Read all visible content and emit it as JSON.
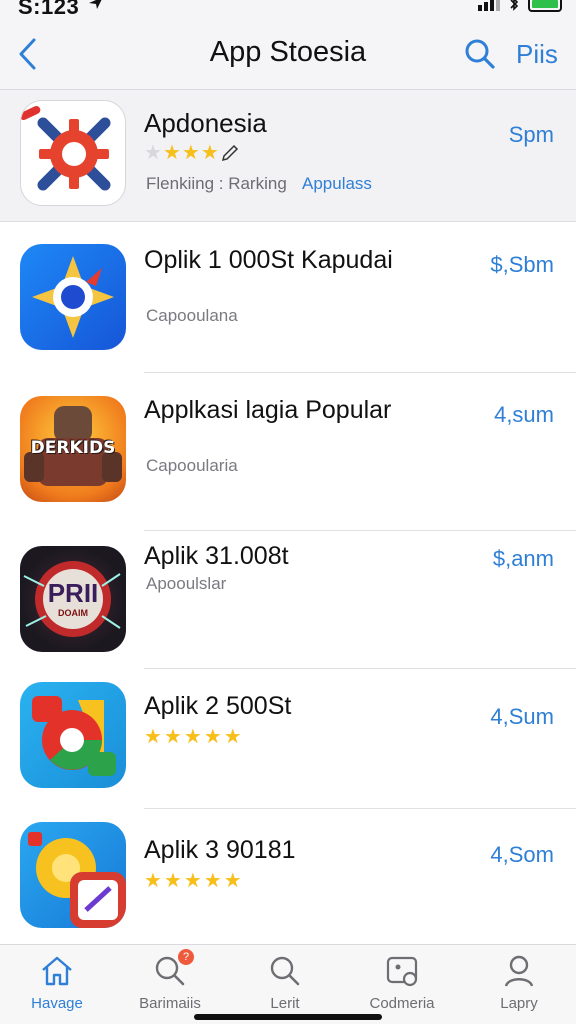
{
  "status": {
    "time": "S:123",
    "battery_level": 1.0
  },
  "nav": {
    "title": "App Stoesia",
    "right_label": "Piis"
  },
  "featured": {
    "name": "Apdonesia",
    "rating": 3.5,
    "subtitle": "Flenkiing : Rarking",
    "link": "Appulass",
    "price": "Spm"
  },
  "apps": [
    {
      "title": "Oplik 1 000St Kapudai",
      "subtitle": "Capooulana",
      "price": "$,Sbm",
      "rating": null,
      "icon": "compass-app-icon"
    },
    {
      "title": "Applkasi lagia Popular",
      "subtitle": "Capooularia",
      "price": "4,sum",
      "rating": null,
      "icon": "robot-game-app-icon",
      "icon_text": "DERKIDS"
    },
    {
      "title": "Aplik 31.008t",
      "subtitle": "Apooulslar",
      "price": "$,anm",
      "rating": null,
      "icon": "prii-app-icon",
      "icon_text": "PRII",
      "icon_subtext": "DOAIM"
    },
    {
      "title": "Aplik 2 500St",
      "subtitle": "",
      "price": "4,Sum",
      "rating": 5,
      "icon": "camera-app-icon"
    },
    {
      "title": "Aplik 3 90181",
      "subtitle": "",
      "price": "4,Som",
      "rating": 5,
      "icon": "media-app-icon"
    }
  ],
  "tabs": [
    {
      "label": "Havage",
      "icon": "home-icon",
      "active": true
    },
    {
      "label": "Barimaiis",
      "icon": "search-badge-icon",
      "badge": "?"
    },
    {
      "label": "Lerit",
      "icon": "search-icon"
    },
    {
      "label": "Codmeria",
      "icon": "photo-icon"
    },
    {
      "label": "Lapry",
      "icon": "person-icon"
    }
  ],
  "colors": {
    "accent": "#2f7fd6",
    "star": "#f7bf1a",
    "battery": "#2fbf4b"
  }
}
